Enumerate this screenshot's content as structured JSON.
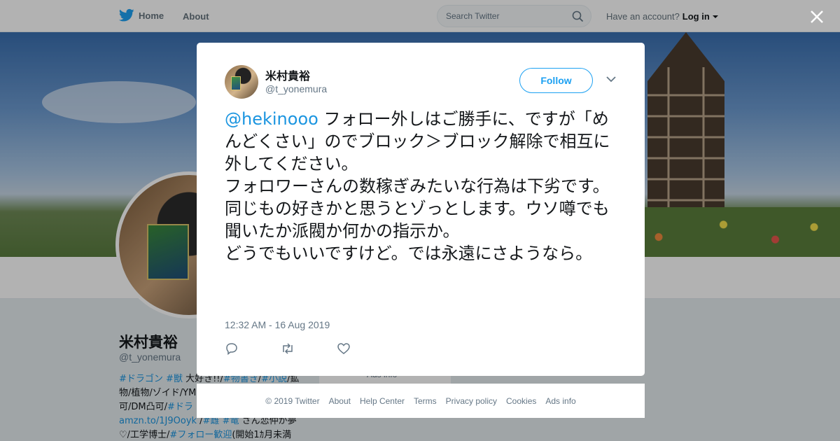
{
  "nav": {
    "home_label": "Home",
    "about_label": "About",
    "search_placeholder": "Search Twitter",
    "account_prompt": "Have an account?",
    "login_label": "Log in",
    "brand_color": "#1da1f2"
  },
  "background_profile": {
    "name": "米村貴裕",
    "handle": "@t_yonemura",
    "bio_lines": [
      [
        "#ドラゴン",
        " ",
        "#獣",
        " 大好き!!/",
        "#物書き",
        "/",
        "#小説",
        "/鉱"
      ],
      [
        "物/植物/ゾイド/YM"
      ],
      [
        "可/DM凸可/",
        "#ドラ"
      ],
      [
        "amzn.to/1J9Ooyk",
        " /",
        "#雌",
        " ",
        "#竜",
        " さん恋仲が夢"
      ],
      [
        "♡/工学博士/",
        "#フォロー歓迎",
        "(開始1ｶ月未満"
      ]
    ],
    "ads_label": "Ads info"
  },
  "tweet": {
    "author_name": "米村貴裕",
    "author_handle": "@t_yonemura",
    "follow_label": "Follow",
    "mention": "@hekinooo",
    "text": " フォロー外しはご勝手に、ですが「めんどくさい」のでブロック＞ブロック解除で相互に外してください。\nフォロワーさんの数稼ぎみたいな行為は下劣です。同じもの好きかと思うとゾっとします。ウソ噂でも聞いたか派閥か何かの指示か。\nどうでもいいですけど。では永遠にさようなら。",
    "timestamp": "12:32 AM - 16 Aug 2019"
  },
  "footer": {
    "links": [
      "© 2019 Twitter",
      "About",
      "Help Center",
      "Terms",
      "Privacy policy",
      "Cookies",
      "Ads info"
    ]
  },
  "icons": [
    "twitter-bird-icon",
    "search-icon",
    "caret-down-icon",
    "close-icon",
    "chevron-down-icon",
    "reply-icon",
    "retweet-icon",
    "like-icon"
  ]
}
